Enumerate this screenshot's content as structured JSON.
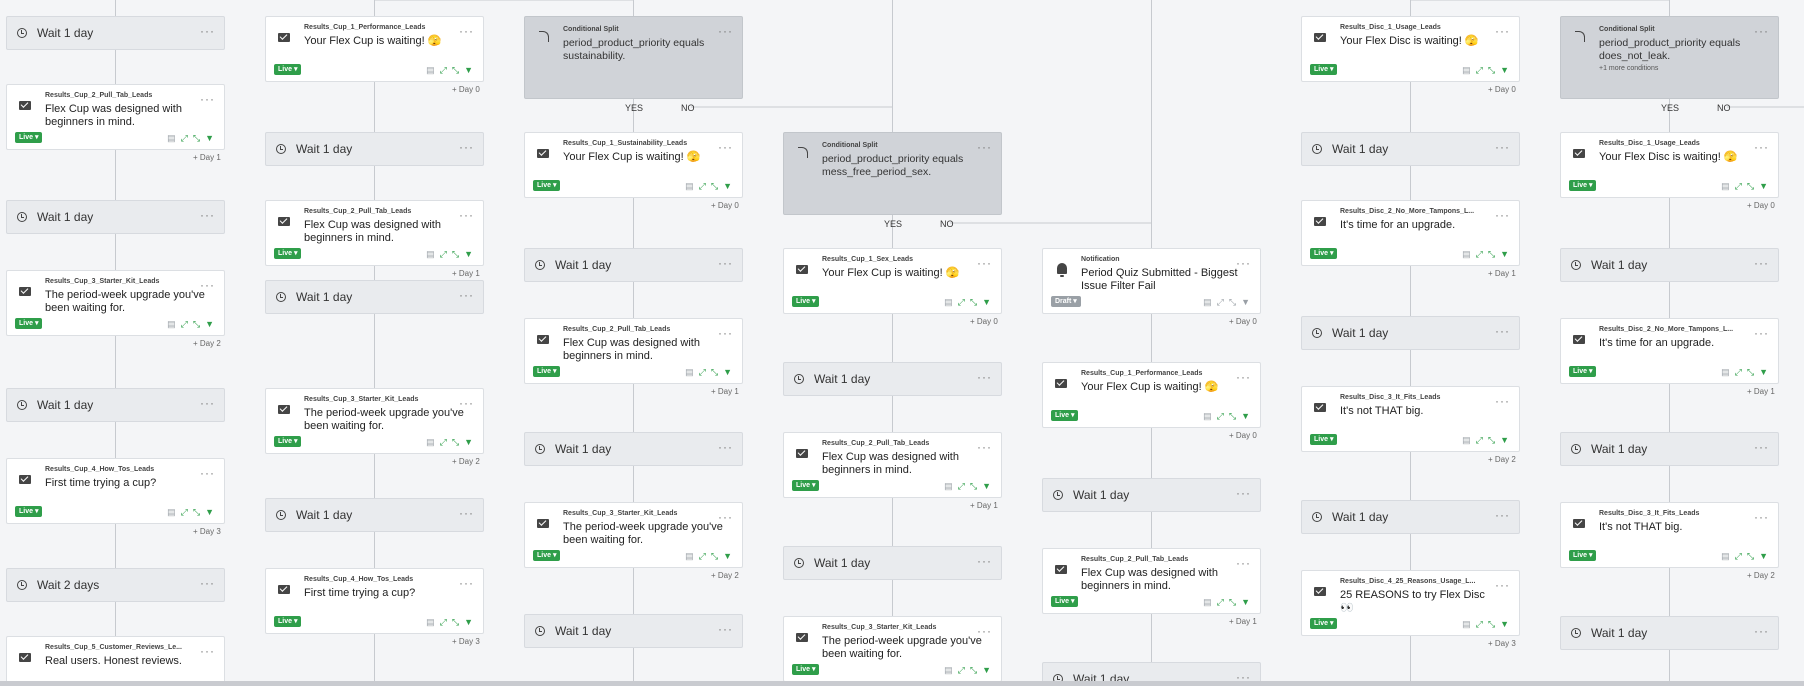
{
  "status_labels": {
    "live": "Live ▾",
    "draft": "Draft ▾"
  },
  "more_menu": "···",
  "branch_labels": {
    "yes": "YES",
    "no": "NO"
  },
  "colors": {
    "live_badge": "#2f9e4a",
    "wait_card": "#e9ebee",
    "split_card": "#d0d3d8",
    "canvas": "#f4f5f7",
    "connector": "#c7cacf"
  },
  "icons": {
    "wait": "clock-icon",
    "email": "envelope-icon",
    "split": "split-icon",
    "notification": "bell-icon",
    "actions": [
      "message-icon",
      "share-icon",
      "link-icon",
      "filter-icon"
    ]
  },
  "nodes": [
    {
      "kind": "wait",
      "label": "Wait 1 day"
    },
    {
      "kind": "email",
      "msg_id": "Results_Cup_2_Pull_Tab_Leads",
      "subject": "Flex Cup was designed with beginners in mind.",
      "status": "live",
      "delay": "+ Day 1"
    },
    {
      "kind": "wait",
      "label": "Wait 1 day"
    },
    {
      "kind": "email",
      "msg_id": "Results_Cup_3_Starter_Kit_Leads",
      "subject": "The period-week upgrade you've been waiting for.",
      "status": "live",
      "delay": "+ Day 2"
    },
    {
      "kind": "wait",
      "label": "Wait 1 day"
    },
    {
      "kind": "email",
      "msg_id": "Results_Cup_4_How_Tos_Leads",
      "subject": "First time trying a cup?",
      "status": "live",
      "delay": "+ Day 3"
    },
    {
      "kind": "wait",
      "label": "Wait 2 days"
    },
    {
      "kind": "email",
      "msg_id": "Results_Cup_5_Customer_Reviews_Le...",
      "subject": "Real users. Honest reviews.",
      "status": "live",
      "delay": ""
    },
    {
      "kind": "email",
      "msg_id": "Results_Cup_1_Performance_Leads",
      "subject": "Your Flex Cup is waiting! 🫣",
      "status": "live",
      "delay": "+ Day 0"
    },
    {
      "kind": "wait",
      "label": "Wait 1 day"
    },
    {
      "kind": "email",
      "msg_id": "Results_Cup_2_Pull_Tab_Leads",
      "subject": "Flex Cup was designed with beginners in mind.",
      "status": "live",
      "delay": "+ Day 1"
    },
    {
      "kind": "wait",
      "label": "Wait 1 day"
    },
    {
      "kind": "email",
      "msg_id": "Results_Cup_3_Starter_Kit_Leads",
      "subject": "The period-week upgrade you've been waiting for.",
      "status": "live",
      "delay": "+ Day 2"
    },
    {
      "kind": "wait",
      "label": "Wait 1 day"
    },
    {
      "kind": "email",
      "msg_id": "Results_Cup_4_How_Tos_Leads",
      "subject": "First time trying a cup?",
      "status": "live",
      "delay": "+ Day 3"
    },
    {
      "kind": "split",
      "type_label": "Conditional Split",
      "condition": "period_product_priority equals sustainability.",
      "more": ""
    },
    {
      "kind": "email",
      "msg_id": "Results_Cup_1_Sustainability_Leads",
      "subject": "Your Flex Cup is waiting! 🫣",
      "status": "live",
      "delay": "+ Day 0"
    },
    {
      "kind": "wait",
      "label": "Wait 1 day"
    },
    {
      "kind": "email",
      "msg_id": "Results_Cup_2_Pull_Tab_Leads",
      "subject": "Flex Cup was designed with beginners in mind.",
      "status": "live",
      "delay": "+ Day 1"
    },
    {
      "kind": "wait",
      "label": "Wait 1 day"
    },
    {
      "kind": "email",
      "msg_id": "Results_Cup_3_Starter_Kit_Leads",
      "subject": "The period-week upgrade you've been waiting for.",
      "status": "live",
      "delay": "+ Day 2"
    },
    {
      "kind": "wait",
      "label": "Wait 1 day"
    },
    {
      "kind": "split",
      "type_label": "Conditional Split",
      "condition": "period_product_priority equals mess_free_period_sex.",
      "more": ""
    },
    {
      "kind": "email",
      "msg_id": "Results_Cup_1_Sex_Leads",
      "subject": "Your Flex Cup is waiting! 🫣",
      "status": "live",
      "delay": "+ Day 0"
    },
    {
      "kind": "wait",
      "label": "Wait 1 day"
    },
    {
      "kind": "email",
      "msg_id": "Results_Cup_2_Pull_Tab_Leads",
      "subject": "Flex Cup was designed with beginners in mind.",
      "status": "live",
      "delay": "+ Day 1"
    },
    {
      "kind": "wait",
      "label": "Wait 1 day"
    },
    {
      "kind": "email",
      "msg_id": "Results_Cup_3_Starter_Kit_Leads",
      "subject": "The period-week upgrade you've been waiting for.",
      "status": "live",
      "delay": ""
    },
    {
      "kind": "notification",
      "msg_id": "Notification",
      "subject": "Period Quiz Submitted - Biggest Issue Filter Fail",
      "status": "draft",
      "delay": "+ Day 0"
    },
    {
      "kind": "email",
      "msg_id": "Results_Cup_1_Performance_Leads",
      "subject": "Your Flex Cup is waiting! 🫣",
      "status": "live",
      "delay": "+ Day 0"
    },
    {
      "kind": "wait",
      "label": "Wait 1 day"
    },
    {
      "kind": "email",
      "msg_id": "Results_Cup_2_Pull_Tab_Leads",
      "subject": "Flex Cup was designed with beginners in mind.",
      "status": "live",
      "delay": "+ Day 1"
    },
    {
      "kind": "wait",
      "label": "Wait 1 day"
    },
    {
      "kind": "email",
      "msg_id": "Results_Disc_1_Usage_Leads",
      "subject": "Your Flex Disc is waiting! 🫣",
      "status": "live",
      "delay": "+ Day 0"
    },
    {
      "kind": "wait",
      "label": "Wait 1 day"
    },
    {
      "kind": "email",
      "msg_id": "Results_Disc_2_No_More_Tampons_L...",
      "subject": "It's time for an upgrade.",
      "status": "live",
      "delay": "+ Day 1"
    },
    {
      "kind": "wait",
      "label": "Wait 1 day"
    },
    {
      "kind": "email",
      "msg_id": "Results_Disc_3_It_Fits_Leads",
      "subject": "It's not THAT big.",
      "status": "live",
      "delay": "+ Day 2"
    },
    {
      "kind": "wait",
      "label": "Wait 1 day"
    },
    {
      "kind": "email",
      "msg_id": "Results_Disc_4_25_Reasons_Usage_L...",
      "subject": "25 REASONS to try Flex Disc 👀",
      "status": "live",
      "delay": "+ Day 3"
    },
    {
      "kind": "split",
      "type_label": "Conditional Split",
      "condition": "period_product_priority equals does_not_leak.",
      "more": "+1 more conditions"
    },
    {
      "kind": "email",
      "msg_id": "Results_Disc_1_Usage_Leads",
      "subject": "Your Flex Disc is waiting! 🫣",
      "status": "live",
      "delay": "+ Day 0"
    },
    {
      "kind": "wait",
      "label": "Wait 1 day"
    },
    {
      "kind": "email",
      "msg_id": "Results_Disc_2_No_More_Tampons_L...",
      "subject": "It's time for an upgrade.",
      "status": "live",
      "delay": "+ Day 1"
    },
    {
      "kind": "wait",
      "label": "Wait 1 day"
    },
    {
      "kind": "email",
      "msg_id": "Results_Disc_3_It_Fits_Leads",
      "subject": "It's not THAT big.",
      "status": "live",
      "delay": "+ Day 2"
    },
    {
      "kind": "wait",
      "label": "Wait 1 day"
    }
  ]
}
